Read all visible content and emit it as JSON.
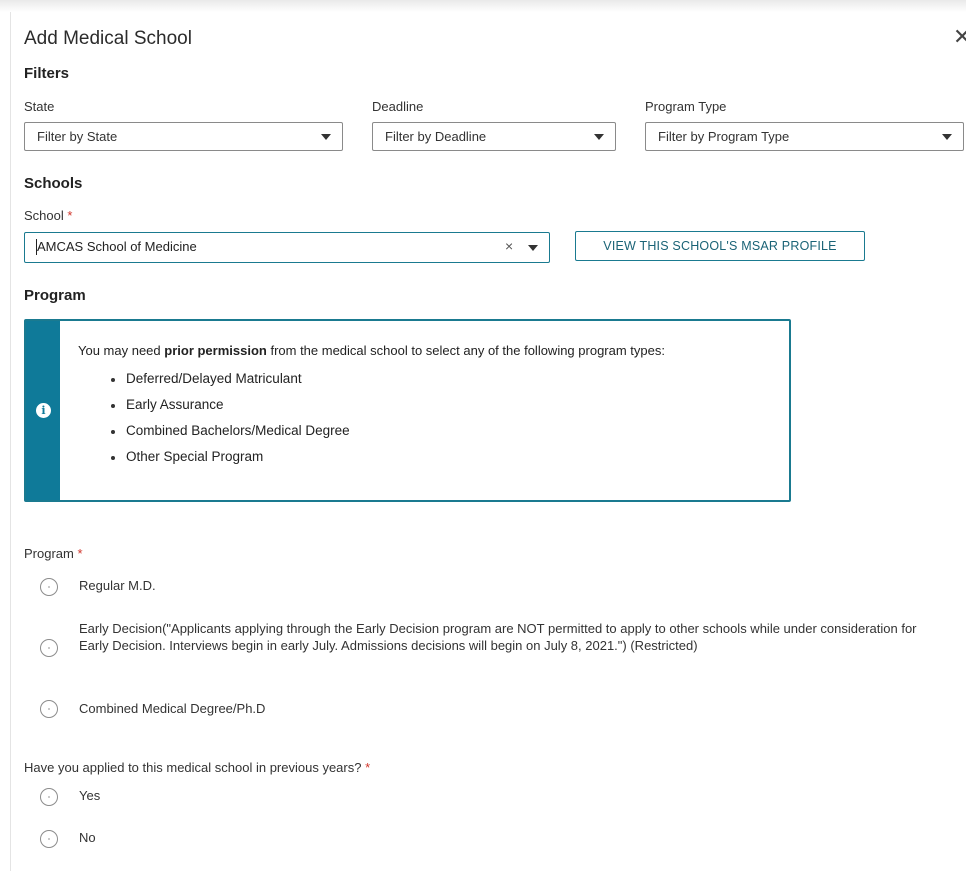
{
  "dialog": {
    "title": "Add Medical School",
    "close_glyph": "✕"
  },
  "filters": {
    "heading": "Filters",
    "state": {
      "label": "State",
      "placeholder": "Filter by State"
    },
    "deadline": {
      "label": "Deadline",
      "placeholder": "Filter by Deadline"
    },
    "program_type": {
      "label": "Program Type",
      "placeholder": "Filter by Program Type"
    }
  },
  "schools": {
    "heading": "Schools",
    "school_label": "School",
    "required_mark": "*",
    "school_value": "AMCAS School of Medicine",
    "clear_glyph": "×",
    "msar_button": "VIEW THIS SCHOOL'S MSAR PROFILE"
  },
  "program": {
    "heading": "Program",
    "info": {
      "icon": "info-icon",
      "text_before": "You may need ",
      "text_bold": "prior permission",
      "text_after": " from the medical school to select any of the following program types:",
      "items": [
        "Deferred/Delayed Matriculant",
        "Early Assurance",
        "Combined Bachelors/Medical Degree",
        "Other Special Program"
      ]
    },
    "field_label": "Program",
    "options": [
      "Regular M.D.",
      "Early Decision(\"Applicants applying through the Early Decision program are NOT permitted to apply to other schools while under consideration for Early Decision. Interviews begin in early July. Admissions decisions will begin on July 8, 2021.\") (Restricted)",
      "Combined Medical Degree/Ph.D"
    ]
  },
  "previous": {
    "question": "Have you applied to this medical school in previous years?",
    "options": [
      "Yes",
      "No"
    ]
  },
  "colors": {
    "accent": "#0f7a99",
    "required": "#d0352b"
  }
}
